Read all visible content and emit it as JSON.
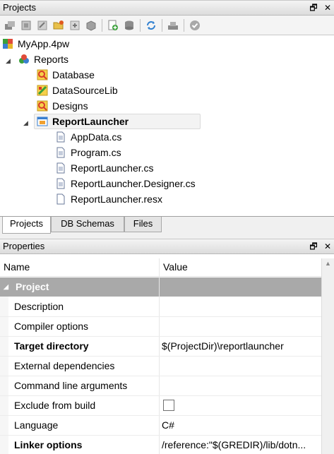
{
  "projects_panel": {
    "title": "Projects",
    "controls": {
      "float": "🗗",
      "close": "✕"
    }
  },
  "toolbar": {
    "icons": [
      "build-icon",
      "build-all-icon",
      "clean-icon",
      "open-folder-icon",
      "settings-icon",
      "package-icon",
      "add-item-icon",
      "database-icon",
      "refresh-icon",
      "deploy-icon",
      "validate-icon"
    ]
  },
  "tree": {
    "root": {
      "label": "MyApp.4pw"
    },
    "reports": {
      "label": "Reports",
      "expander": "◢"
    },
    "items": [
      {
        "label": "Database"
      },
      {
        "label": "DataSourceLib"
      },
      {
        "label": "Designs"
      }
    ],
    "report_launcher": {
      "label": "ReportLauncher",
      "expander": "◢"
    },
    "files": [
      {
        "label": "AppData.cs"
      },
      {
        "label": "Program.cs"
      },
      {
        "label": "ReportLauncher.cs"
      },
      {
        "label": "ReportLauncher.Designer.cs"
      },
      {
        "label": "ReportLauncher.resx"
      }
    ]
  },
  "bottom_tabs": [
    {
      "label": "Projects",
      "active": true
    },
    {
      "label": "DB Schemas",
      "active": false
    },
    {
      "label": "Files",
      "active": false
    }
  ],
  "properties_panel": {
    "title": "Properties",
    "controls": {
      "float": "🗗",
      "close": "✕"
    },
    "columns": {
      "name": "Name",
      "value": "Value"
    },
    "category": {
      "label": "Project",
      "expander": "◢"
    },
    "rows": [
      {
        "name": "Description",
        "value": "",
        "bold": false
      },
      {
        "name": "Compiler options",
        "value": "",
        "bold": false
      },
      {
        "name": "Target directory",
        "value": "$(ProjectDir)\\reportlauncher",
        "bold": true
      },
      {
        "name": "External dependencies",
        "value": "",
        "bold": false
      },
      {
        "name": "Command line arguments",
        "value": "",
        "bold": false
      },
      {
        "name": "Exclude from build",
        "value": "",
        "bold": false,
        "checkbox": true,
        "checked": false
      },
      {
        "name": "Language",
        "value": "C#",
        "bold": false
      },
      {
        "name": "Linker options",
        "value": "/reference:\"$(GREDIR)/lib/dotn...",
        "bold": true
      }
    ]
  }
}
